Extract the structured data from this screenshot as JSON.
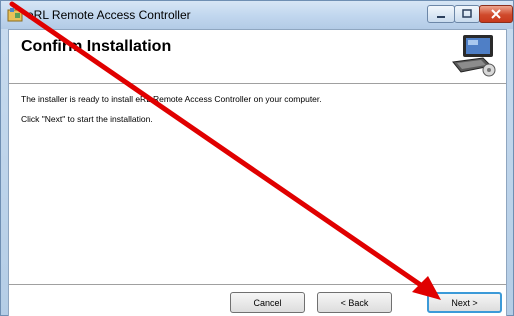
{
  "window": {
    "title": "eRL Remote Access Controller",
    "icon": "installer-icon",
    "caption_buttons": [
      "minimize",
      "maximize",
      "close"
    ]
  },
  "header": {
    "title": "Confirm Installation",
    "logo": "computer-install-icon"
  },
  "body": {
    "line1": "The installer is ready to install eRL Remote Access Controller on your computer.",
    "line2": "Click \"Next\" to start the installation."
  },
  "buttons": {
    "cancel": "Cancel",
    "back": "< Back",
    "next": "Next >"
  },
  "annotation": {
    "type": "red-arrow",
    "color": "#e00000"
  }
}
